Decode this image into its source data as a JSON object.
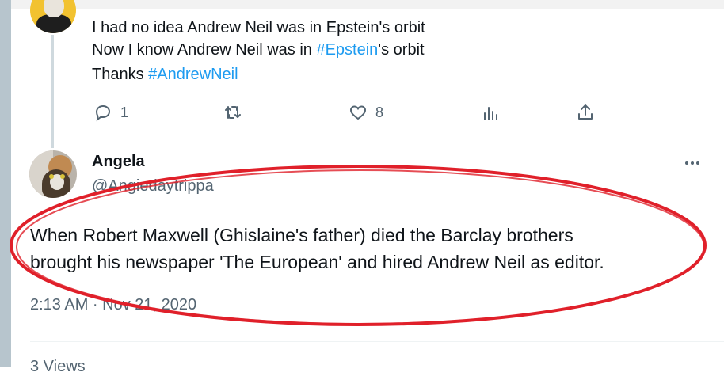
{
  "reply": {
    "lines": [
      {
        "text": "I had no idea Andrew Neil was in Epstein's orbit"
      },
      {
        "before": "Now I know Andrew Neil was in ",
        "hashtag": "#Epstein",
        "after": "'s orbit"
      },
      {
        "before": "Thanks ",
        "hashtag": "#AndrewNeil"
      }
    ],
    "actions": {
      "reply_count": "1",
      "retweet_count": "",
      "like_count": "8"
    }
  },
  "tweet": {
    "author_name": "Angela",
    "author_handle": "@Angiedaytrippa",
    "body_lines": [
      "When Robert Maxwell (Ghislaine's father) died the Barclay brothers",
      "brought his newspaper 'The European' and hired Andrew Neil as editor."
    ],
    "timestamp": "2:13 AM · Nov 21, 2020",
    "views": "3 Views"
  },
  "icons": {
    "reply": "reply-icon",
    "retweet": "retweet-icon",
    "like": "heart-icon",
    "analytics": "analytics-icon",
    "share": "share-icon",
    "more": "more-icon"
  },
  "colors": {
    "hashtag": "#1d9bf0",
    "annotation": "#e0202a",
    "secondary_text": "#536471"
  }
}
